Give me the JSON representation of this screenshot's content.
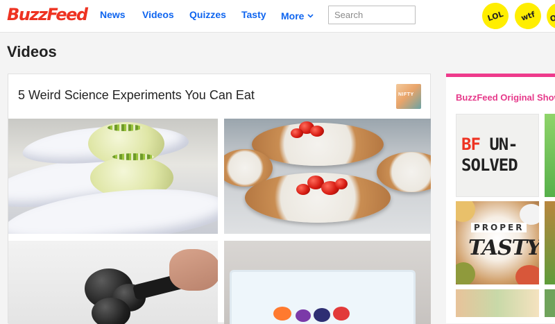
{
  "header": {
    "logo": "BuzzFeed",
    "nav": [
      {
        "label": "News"
      },
      {
        "label": "Videos"
      },
      {
        "label": "Quizzes"
      },
      {
        "label": "Tasty"
      },
      {
        "label": "More"
      }
    ],
    "search_placeholder": "Search",
    "badges": [
      "LOL",
      "wtf",
      "OMG"
    ]
  },
  "page": {
    "title": "Videos"
  },
  "video_card": {
    "title": "5 Weird Science Experiments You Can Eat",
    "channel_thumb_label": "NIFTY"
  },
  "sidebar": {
    "title": "BuzzFeed Original Shows",
    "shows": {
      "unsolved_line1_bf": "BF",
      "unsolved_line1_rest": " UN-",
      "unsolved_line2": "SOLVED",
      "tasty_line1": "PROPER",
      "tasty_line2": "TASTY"
    }
  },
  "colors": {
    "brand": "#ee3322",
    "nav_link": "#0f65ef",
    "badge": "#ffee00",
    "sidebar_accent": "#ee3a8c"
  }
}
